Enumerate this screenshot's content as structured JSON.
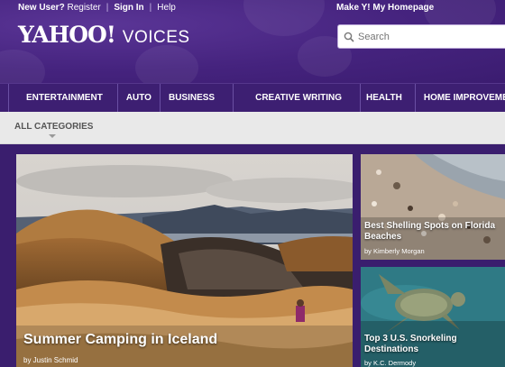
{
  "topnav": {
    "new_user": "New User?",
    "register": "Register",
    "sign_in": "Sign In",
    "help": "Help",
    "make_homepage": "Make Y! My Homepage"
  },
  "logo": {
    "yahoo": "YAHOO!",
    "voices": "VOICES"
  },
  "search": {
    "placeholder": "Search"
  },
  "categories": [
    "ENTERTAINMENT",
    "AUTO",
    "BUSINESS",
    "CREATIVE WRITING",
    "HEALTH",
    "HOME IMPROVEMENT"
  ],
  "all_categories": "ALL CATEGORIES",
  "hero": {
    "title": "Summer Camping in Iceland",
    "byline": "by Justin Schmid"
  },
  "side_cards": [
    {
      "title": "Best Shelling Spots on Florida Beaches",
      "byline": "by Kimberly Morgan"
    },
    {
      "title": "Top 3 U.S. Snorkeling Destinations",
      "byline": "by K.C. Dermody"
    }
  ],
  "colors": {
    "brand_purple": "#3b1c70",
    "category_bar": "#e9e9e9"
  }
}
